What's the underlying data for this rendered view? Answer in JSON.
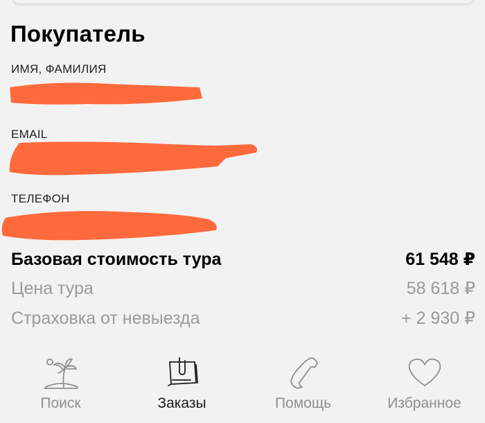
{
  "buyer": {
    "title": "Покупатель",
    "fields": [
      {
        "label": "ИМЯ, ФАМИЛИЯ",
        "value_redacted": true
      },
      {
        "label": "EMAIL",
        "value_redacted": true
      },
      {
        "label": "ТЕЛЕФОН",
        "value_redacted": true
      }
    ]
  },
  "pricing": {
    "base": {
      "label": "Базовая стоимость тура",
      "value": "61 548 ₽"
    },
    "tour": {
      "label": "Цена тура",
      "value": "58 618 ₽"
    },
    "insurance": {
      "label": "Страховка от невыезда",
      "value": "+ 2 930 ₽"
    }
  },
  "tabbar": {
    "tabs": [
      {
        "label": "Поиск",
        "icon": "palm-island-icon",
        "active": false
      },
      {
        "label": "Заказы",
        "icon": "clipboard-icon",
        "active": true
      },
      {
        "label": "Помощь",
        "icon": "phone-icon",
        "active": false
      },
      {
        "label": "Избранное",
        "icon": "heart-icon",
        "active": false
      }
    ]
  },
  "colors": {
    "background": "#f2f2f2",
    "redaction": "#ff6a3d",
    "inactive_tab": "#8e8e8e",
    "secondary_text": "#9a9a9a"
  }
}
